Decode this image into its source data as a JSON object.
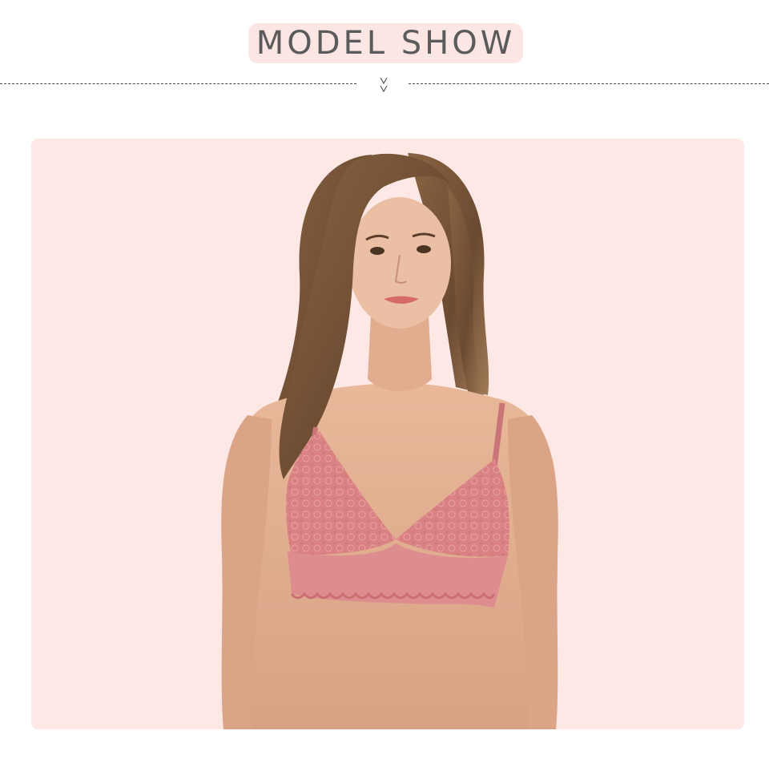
{
  "header": {
    "title": "MODEL SHOW"
  },
  "divider": {
    "icon": "double-chevron-down-icon"
  },
  "photo": {
    "description_icon": "model-photo",
    "background_color": "#fde8e6",
    "bra_color": "#d98183"
  }
}
